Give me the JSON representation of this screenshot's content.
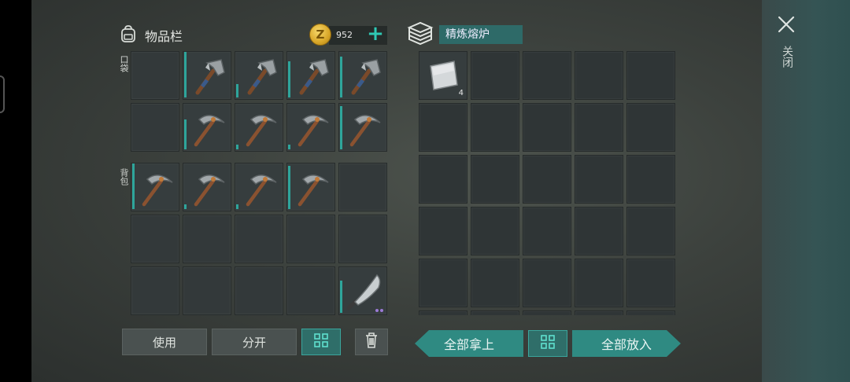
{
  "inventory": {
    "title": "物品栏",
    "coins": "952",
    "pocket_label": "口袋",
    "backpack_label": "背包",
    "pocket_slots": [
      {
        "item": "",
        "durability": 0
      },
      {
        "item": "hammer",
        "durability": 1.0
      },
      {
        "item": "hammer",
        "durability": 0.3
      },
      {
        "item": "hammer",
        "durability": 0.8
      },
      {
        "item": "hammer",
        "durability": 0.9
      },
      {
        "item": "",
        "durability": 0
      },
      {
        "item": "pickaxe",
        "durability": 0.65
      },
      {
        "item": "pickaxe",
        "durability": 0.1
      },
      {
        "item": "pickaxe",
        "durability": 0.1
      },
      {
        "item": "pickaxe",
        "durability": 0.95
      }
    ],
    "backpack_slots": [
      {
        "item": "pickaxe",
        "durability": 1.0
      },
      {
        "item": "pickaxe",
        "durability": 0.1
      },
      {
        "item": "pickaxe",
        "durability": 0.1
      },
      {
        "item": "pickaxe",
        "durability": 0.95
      },
      {
        "item": "",
        "durability": 0
      },
      {
        "item": "",
        "durability": 0
      },
      {
        "item": "",
        "durability": 0
      },
      {
        "item": "",
        "durability": 0
      },
      {
        "item": "",
        "durability": 0
      },
      {
        "item": "",
        "durability": 0
      },
      {
        "item": "",
        "durability": 0
      },
      {
        "item": "",
        "durability": 0
      },
      {
        "item": "",
        "durability": 0
      },
      {
        "item": "",
        "durability": 0
      },
      {
        "item": "machete",
        "durability": 0.7
      }
    ],
    "buttons": {
      "use": "使用",
      "split": "分开"
    }
  },
  "furnace": {
    "title": "精炼熔炉",
    "first_slot_count": "4",
    "buttons": {
      "take_all": "全部拿上",
      "put_all": "全部放入"
    }
  },
  "close_label": "关闭",
  "colors": {
    "accent": "#2ea59b",
    "rarity_dots": "#9b7ad6"
  }
}
